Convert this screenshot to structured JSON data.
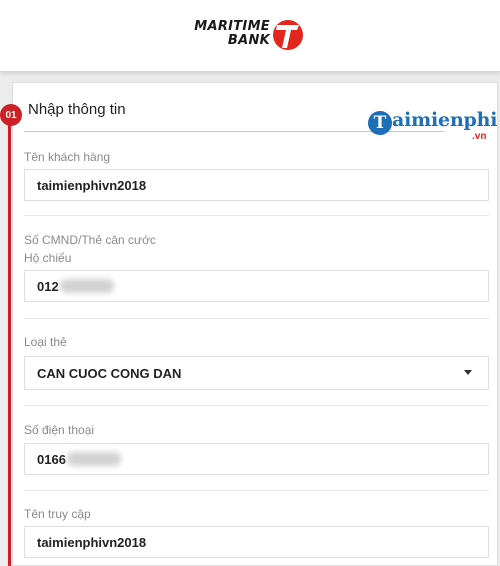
{
  "brand": {
    "logo_line1": "MARITIME",
    "logo_line2": "BANK",
    "logo_color": "#e4261c"
  },
  "watermark": {
    "initial": "T",
    "text": "aimienphi",
    "suffix": ".vn",
    "color": "#1e6fb8"
  },
  "step": {
    "number": "01",
    "title": "Nhập thông tin",
    "accent_color": "#cc1f26"
  },
  "fields": {
    "customer_name": {
      "label": "Tên khách hàng",
      "value": "taimienphivn2018"
    },
    "id_number": {
      "label_line1": "Số CMND/Thẻ căn cước",
      "label_line2": "Hộ chiếu",
      "value_visible": "012"
    },
    "card_type": {
      "label": "Loại thẻ",
      "selected": "CAN CUOC CONG DAN"
    },
    "phone": {
      "label": "Số điện thoại",
      "value_visible": "0166"
    },
    "username": {
      "label": "Tên truy cập",
      "value": "taimienphivn2018"
    }
  }
}
